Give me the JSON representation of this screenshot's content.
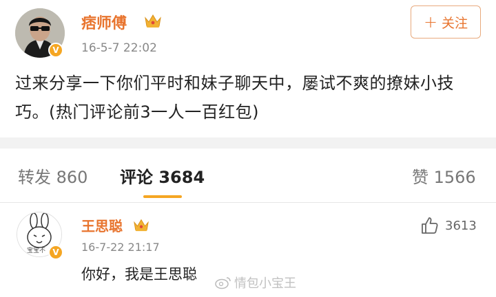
{
  "post": {
    "author": "痞师傅",
    "time": "16-5-7 22:02",
    "follow_label": "关注",
    "text": "过来分享一下你们平时和妹子聊天中，屡试不爽的撩妹小技巧。(热门评论前3一人一百红包)"
  },
  "tabs": {
    "repost": "转发 860",
    "comments": "评论 3684",
    "likes": "赞 1566"
  },
  "comment": {
    "author": "王思聪",
    "time": "16-7-22 21:17",
    "likes": "3613",
    "text": "你好，我是王思聪",
    "avatar_caption": "宝宝不"
  },
  "watermark": "情包小宝王",
  "colors": {
    "accent": "#e8742e",
    "verified": "#f5a623",
    "crown": "#f2b233"
  }
}
